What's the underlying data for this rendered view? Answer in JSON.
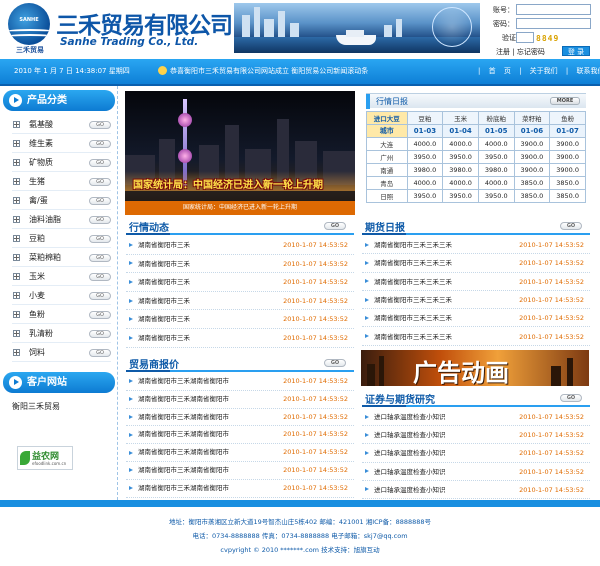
{
  "header": {
    "logo_mark_text": "SANHE",
    "logo_sub": "三禾贸易",
    "company_cn": "三禾贸易有限公司",
    "company_en": "Sanhe Trading Co., Ltd."
  },
  "login": {
    "account_label": "账号：",
    "password_label": "密码：",
    "captcha_label": "验证码：",
    "captcha_value": "8849",
    "register_label": "注册",
    "forgot_label": "忘记密码",
    "login_button": "登 录"
  },
  "topbar": {
    "datetime": "2010 年 1 月 7 日  14:38:07  星期四",
    "marquee": "恭喜衡阳市三禾贸易有限公司网站成立  衡阳贸易公司新闻滚动条",
    "nav": [
      "首",
      "页",
      "关于我们",
      "联系我们"
    ]
  },
  "sidebar": {
    "products_title": "产品分类",
    "go_label": "GO",
    "items": [
      "氨基酸",
      "维生素",
      "矿物质",
      "生猪",
      "禽/蛋",
      "油料油脂",
      "豆粕",
      "菜粕棉粕",
      "玉米",
      "小麦",
      "鱼粉",
      "乳清粉",
      "饲料"
    ],
    "customer_title": "客户网站",
    "customer_site": "衡阳三禾贸易",
    "partner_name": "益农网",
    "partner_url": "efoodlink.com.cn"
  },
  "photo": {
    "caption": "国家统计局：中国经济已进入新一轮上升期",
    "bar": "国家统计局：中国经济已进入新一轮上升期"
  },
  "market": {
    "title": "行情日报",
    "more": "MORE",
    "columns": [
      "进口大豆",
      "豆粕",
      "玉米",
      "粉底粕",
      "菜籽粕",
      "鱼粉"
    ],
    "dates": [
      "城市",
      "01-03",
      "01-04",
      "01-05",
      "01-06",
      "01-07"
    ],
    "rows": [
      [
        "大连",
        "4000.0",
        "4000.0",
        "4000.0",
        "3900.0",
        "3900.0"
      ],
      [
        "广州",
        "3950.0",
        "3950.0",
        "3950.0",
        "3900.0",
        "3900.0"
      ],
      [
        "南通",
        "3980.0",
        "3980.0",
        "3980.0",
        "3900.0",
        "3900.0"
      ],
      [
        "青岛",
        "4000.0",
        "4000.0",
        "4000.0",
        "3850.0",
        "3850.0"
      ],
      [
        "日照",
        "3950.0",
        "3950.0",
        "3950.0",
        "3850.0",
        "3850.0"
      ]
    ]
  },
  "sections": {
    "industry": {
      "title": "行情动态",
      "items": [
        {
          "t": "湖南省衡阳市三禾",
          "d": "2010-1-07  14:53:52"
        },
        {
          "t": "湖南省衡阳市三禾",
          "d": "2010-1-07  14:53:52"
        },
        {
          "t": "湖南省衡阳市三禾",
          "d": "2010-1-07  14:53:52"
        },
        {
          "t": "湖南省衡阳市三禾",
          "d": "2010-1-07  14:53:52"
        },
        {
          "t": "湖南省衡阳市三禾",
          "d": "2010-1-07  14:53:52"
        },
        {
          "t": "湖南省衡阳市三禾",
          "d": "2010-1-07  14:53:52"
        }
      ]
    },
    "futures": {
      "title": "期货日报",
      "items": [
        {
          "t": "湖南省衡阳市三禾三禾三禾",
          "d": "2010-1-07  14:53:52"
        },
        {
          "t": "湖南省衡阳市三禾三禾三禾",
          "d": "2010-1-07  14:53:52"
        },
        {
          "t": "湖南省衡阳市三禾三禾三禾",
          "d": "2010-1-07  14:53:52"
        },
        {
          "t": "湖南省衡阳市三禾三禾三禾",
          "d": "2010-1-07  14:53:52"
        },
        {
          "t": "湖南省衡阳市三禾三禾三禾",
          "d": "2010-1-07  14:53:52"
        },
        {
          "t": "湖南省衡阳市三禾三禾三禾",
          "d": "2010-1-07  14:53:52"
        }
      ]
    },
    "traders": {
      "title": "贸易商报价",
      "items": [
        {
          "t": "湖南省衡阳市三禾湖南省衡阳市",
          "d": "2010-1-07  14:53:52"
        },
        {
          "t": "湖南省衡阳市三禾湖南省衡阳市",
          "d": "2010-1-07  14:53:52"
        },
        {
          "t": "湖南省衡阳市三禾湖南省衡阳市",
          "d": "2010-1-07  14:53:52"
        },
        {
          "t": "湖南省衡阳市三禾湖南省衡阳市",
          "d": "2010-1-07  14:53:52"
        },
        {
          "t": "湖南省衡阳市三禾湖南省衡阳市",
          "d": "2010-1-07  14:53:52"
        },
        {
          "t": "湖南省衡阳市三禾湖南省衡阳市",
          "d": "2010-1-07  14:53:52"
        },
        {
          "t": "湖南省衡阳市三禾湖南省衡阳市",
          "d": "2010-1-07  14:53:52"
        }
      ]
    },
    "research": {
      "title": "证券与期货研究",
      "items": [
        {
          "t": "进口轴承温度检查小知识",
          "d": "2010-1-07  14:53:52"
        },
        {
          "t": "进口轴承温度检查小知识",
          "d": "2010-1-07  14:53:52"
        },
        {
          "t": "进口轴承温度检查小知识",
          "d": "2010-1-07  14:53:52"
        },
        {
          "t": "进口轴承温度检查小知识",
          "d": "2010-1-07  14:53:52"
        },
        {
          "t": "进口轴承温度检查小知识",
          "d": "2010-1-07  14:53:52"
        }
      ]
    },
    "ad_text": "广告动画"
  },
  "footer": {
    "address": "地址：衡阳市蒸湘区立新大道19号智杰山庄5栋402  邮编：421001  湘ICP备：8888888号",
    "phone": "电话：0734-8888888  传真：0734-8888888  电子邮箱：skj7@qq.com",
    "copyright": "cvpyright © 2010 *******.com 技术支持：旭旗互动"
  }
}
